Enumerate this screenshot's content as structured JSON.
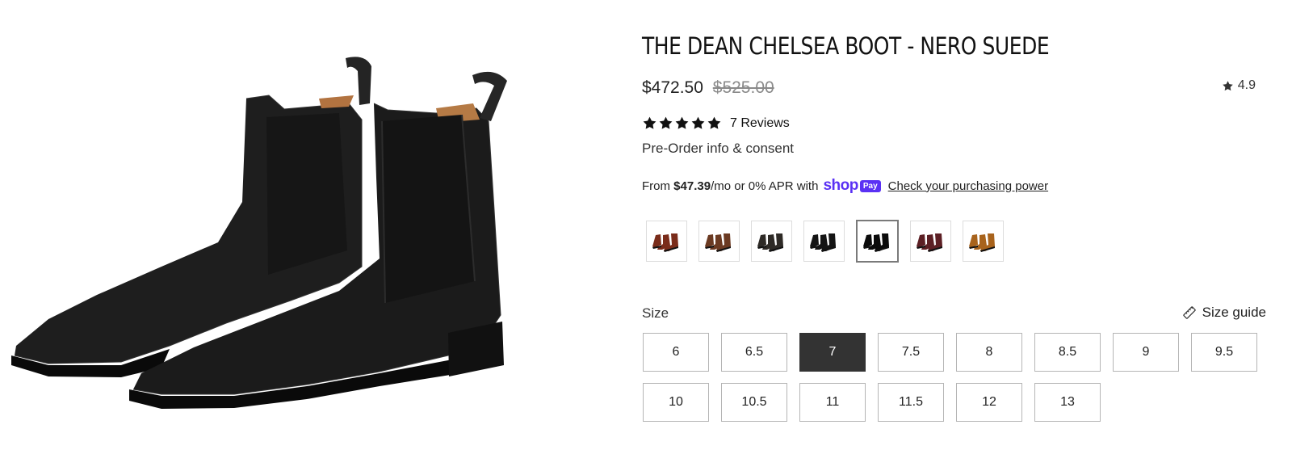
{
  "product": {
    "title": "THE DEAN CHELSEA BOOT - NERO SUEDE",
    "price": "$472.50",
    "compare_price": "$525.00",
    "rating": "4.9",
    "rating_icon": "star-icon",
    "stars": 5,
    "reviews_label": "7 Reviews",
    "preorder_label": "Pre-Order info & consent",
    "image_icon": "chelsea-boot-pair"
  },
  "installments": {
    "prefix": "From ",
    "amount": "$47.39",
    "suffix": "/mo or 0% APR with ",
    "shop_label": "shop",
    "pay_label": "Pay",
    "link_label": "Check your purchasing power"
  },
  "swatches": [
    {
      "color": "#7a2c1a",
      "selected": false
    },
    {
      "color": "#6b3a22",
      "selected": false
    },
    {
      "color": "#2e2a26",
      "selected": false
    },
    {
      "color": "#141414",
      "selected": false
    },
    {
      "color": "#0b0b0b",
      "selected": true
    },
    {
      "color": "#5c1f24",
      "selected": false
    },
    {
      "color": "#a8631c",
      "selected": false
    }
  ],
  "size": {
    "label": "Size",
    "guide_label": "Size guide",
    "guide_icon": "ruler-icon",
    "options": [
      "6",
      "6.5",
      "7",
      "7.5",
      "8",
      "8.5",
      "9",
      "9.5",
      "10",
      "10.5",
      "11",
      "11.5",
      "12",
      "13"
    ],
    "selected": "7"
  },
  "colors": {
    "selected_bg": "#333333",
    "shop_pay": "#5a31f4"
  }
}
